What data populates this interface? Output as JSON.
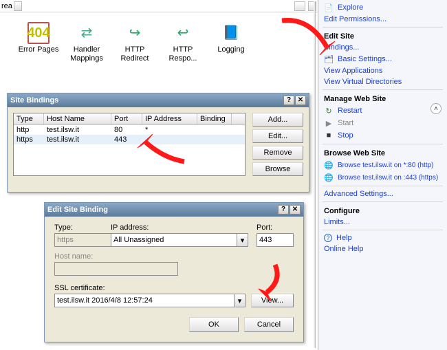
{
  "toolbar": {
    "area_label": "rea"
  },
  "features": {
    "error_pages": "Error Pages",
    "handler_mappings": "Handler Mappings",
    "http_redirect": "HTTP Redirect",
    "http_respo": "HTTP Respo...",
    "logging": "Logging"
  },
  "bindings_dialog": {
    "title": "Site Bindings",
    "headers": {
      "type": "Type",
      "host": "Host Name",
      "port": "Port",
      "ip": "IP Address",
      "binding": "Binding"
    },
    "rows": [
      {
        "type": "http",
        "host": "test.ilsw.it",
        "port": "80",
        "ip": "*"
      },
      {
        "type": "https",
        "host": "test.ilsw.it",
        "port": "443",
        "ip": ""
      }
    ],
    "buttons": {
      "add": "Add...",
      "edit": "Edit...",
      "remove": "Remove",
      "browse": "Browse"
    }
  },
  "edit_dialog": {
    "title": "Edit Site Binding",
    "labels": {
      "type": "Type:",
      "ip": "IP address:",
      "port": "Port:",
      "host": "Host name:",
      "ssl": "SSL certificate:"
    },
    "type_value": "https",
    "ip_value": "All Unassigned",
    "port_value": "443",
    "host_value": "",
    "ssl_value": "test.ilsw.it 2016/4/8 12:57:24",
    "buttons": {
      "view": "View...",
      "ok": "OK",
      "cancel": "Cancel"
    }
  },
  "right_panel": {
    "explore": "Explore",
    "edit_permissions": "Edit Permissions...",
    "edit_site_hdr": "Edit Site",
    "bindings": "Bindings...",
    "basic_settings": "Basic Settings...",
    "view_apps": "View Applications",
    "view_vdirs": "View Virtual Directories",
    "manage_hdr": "Manage Web Site",
    "restart": "Restart",
    "start": "Start",
    "stop": "Stop",
    "browse_hdr": "Browse Web Site",
    "browse_http": "Browse test.ilsw.it on *:80 (http)",
    "browse_https": "Browse test.ilsw.it on :443 (https)",
    "advanced": "Advanced Settings...",
    "configure_hdr": "Configure",
    "limits": "Limits...",
    "help": "Help",
    "online_help": "Online Help"
  },
  "glyphs": {
    "question": "?",
    "close": "✕",
    "dd": "▾",
    "up": "˄",
    "restart": "↻",
    "start": "▶",
    "stop": "■",
    "globe": "🌐",
    "help": "?",
    "folder": "📄",
    "gear": "🗂"
  }
}
